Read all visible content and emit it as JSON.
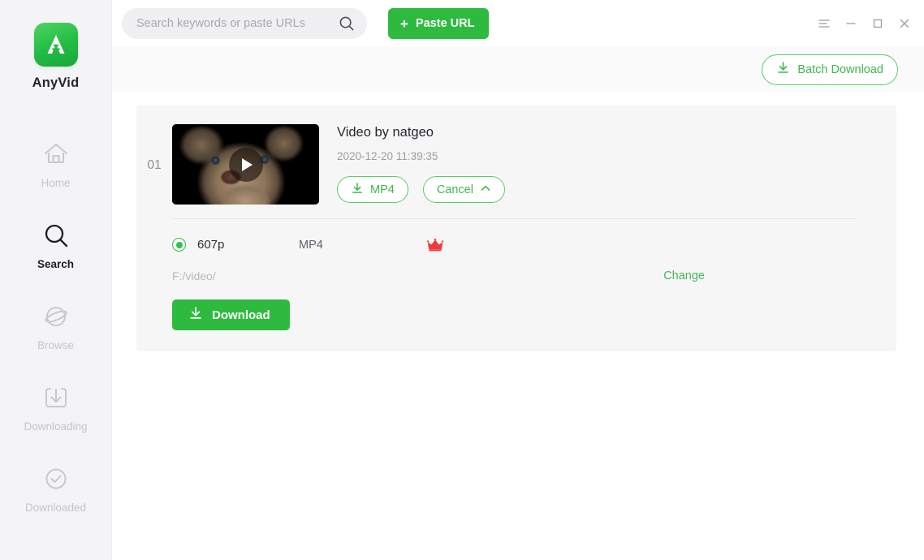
{
  "app": {
    "name": "AnyVid",
    "logo_icon": "anyvid-logo-icon"
  },
  "sidebar": {
    "items": [
      {
        "label": "Home",
        "icon": "home-icon",
        "active": false
      },
      {
        "label": "Search",
        "icon": "search-icon",
        "active": true
      },
      {
        "label": "Browse",
        "icon": "globe-icon",
        "active": false
      },
      {
        "label": "Downloading",
        "icon": "download-box-icon",
        "active": false
      },
      {
        "label": "Downloaded",
        "icon": "check-circle-icon",
        "active": false
      }
    ]
  },
  "topbar": {
    "search": {
      "placeholder": "Search keywords or paste URLs",
      "value": "",
      "icon": "search-icon"
    },
    "paste_url": {
      "label": "Paste URL",
      "plus": "+"
    },
    "window_controls": [
      {
        "name": "menu-icon",
        "glyph": "menu"
      },
      {
        "name": "minimize-icon",
        "glyph": "minimize"
      },
      {
        "name": "maximize-icon",
        "glyph": "maximize"
      },
      {
        "name": "close-icon",
        "glyph": "close"
      }
    ]
  },
  "subbar": {
    "batch_download": {
      "label": "Batch Download",
      "icon": "download-icon"
    }
  },
  "video_card": {
    "index": "01",
    "title": "Video by natgeo",
    "date": "2020-12-20 11:39:35",
    "thumbnail_alt": "video-thumbnail",
    "play_icon": "play-icon",
    "format_button": {
      "label": "MP4",
      "icon": "download-icon"
    },
    "cancel_button": {
      "label": "Cancel",
      "icon": "chevron-up-icon"
    },
    "quality": {
      "selected": true,
      "resolution": "607p",
      "format": "MP4",
      "premium_icon": "crown-icon"
    },
    "path": {
      "value": "F:/video/",
      "change_label": "Change"
    },
    "download_button": {
      "label": "Download",
      "icon": "download-icon"
    }
  },
  "colors": {
    "brand_green": "#2eba3f",
    "outline_green": "#3cb94e",
    "crown_red": "#ef3b3b",
    "sidebar_bg": "#f4f4f6",
    "card_bg": "#f6f6f7"
  }
}
